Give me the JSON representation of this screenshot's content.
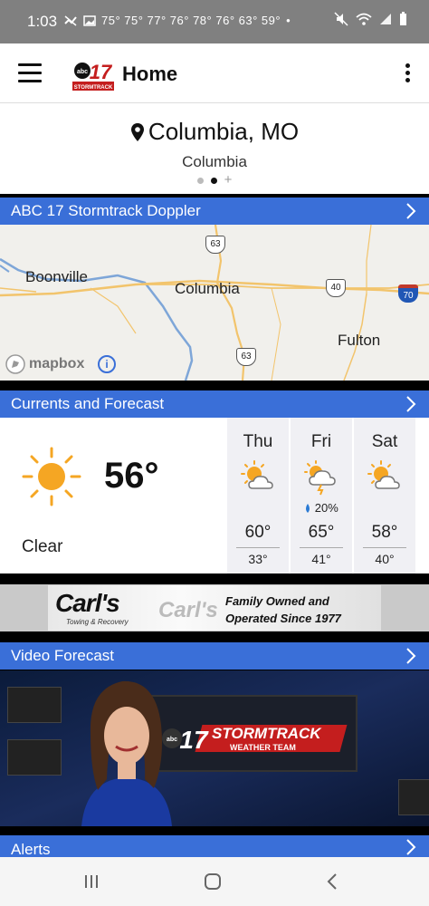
{
  "status_bar": {
    "time": "1:03",
    "temps": "75° 75° 77° 76° 78° 76° 63° 59°",
    "bullet": "•"
  },
  "app_bar": {
    "title": "Home",
    "logo_text": "abc17"
  },
  "location": {
    "name": "Columbia, MO",
    "subtitle": "Columbia",
    "page_indicator": {
      "count": 2,
      "active": 2
    }
  },
  "sections": {
    "doppler_title": "ABC 17 Stormtrack Doppler",
    "currents_title": "Currents and Forecast",
    "video_title": "Video Forecast",
    "alerts_title": "Alerts"
  },
  "map": {
    "labels": {
      "boonville": "Boonville",
      "columbia": "Columbia",
      "fulton": "Fulton"
    },
    "shields": {
      "us63_north": "63",
      "us40": "40",
      "us63_south": "63",
      "i70": "70"
    },
    "attribution": "mapbox",
    "info": "i"
  },
  "current": {
    "temp": "56°",
    "condition": "Clear",
    "icon": "sun-icon"
  },
  "forecast": [
    {
      "day": "Thu",
      "hi": "60°",
      "lo": "33°",
      "precip": "",
      "icon": "partly-cloudy-icon"
    },
    {
      "day": "Fri",
      "hi": "65°",
      "lo": "41°",
      "precip": "20%",
      "icon": "thunderstorm-icon"
    },
    {
      "day": "Sat",
      "hi": "58°",
      "lo": "40°",
      "precip": "",
      "icon": "partly-cloudy-icon"
    }
  ],
  "ad": {
    "brand": "Carl's",
    "brand_echo": "Carl's",
    "tagline": "Towing & Recovery",
    "line1": "Family Owned and",
    "line2": "Operated Since 1977"
  },
  "video": {
    "brand_text": "STORMTRACK",
    "brand_sub": "WEATHER TEAM",
    "logo_text": "abc17"
  },
  "colors": {
    "header_blue": "#3a6fd8",
    "sun_orange": "#f5a623",
    "statusbar_gray": "#808080"
  }
}
